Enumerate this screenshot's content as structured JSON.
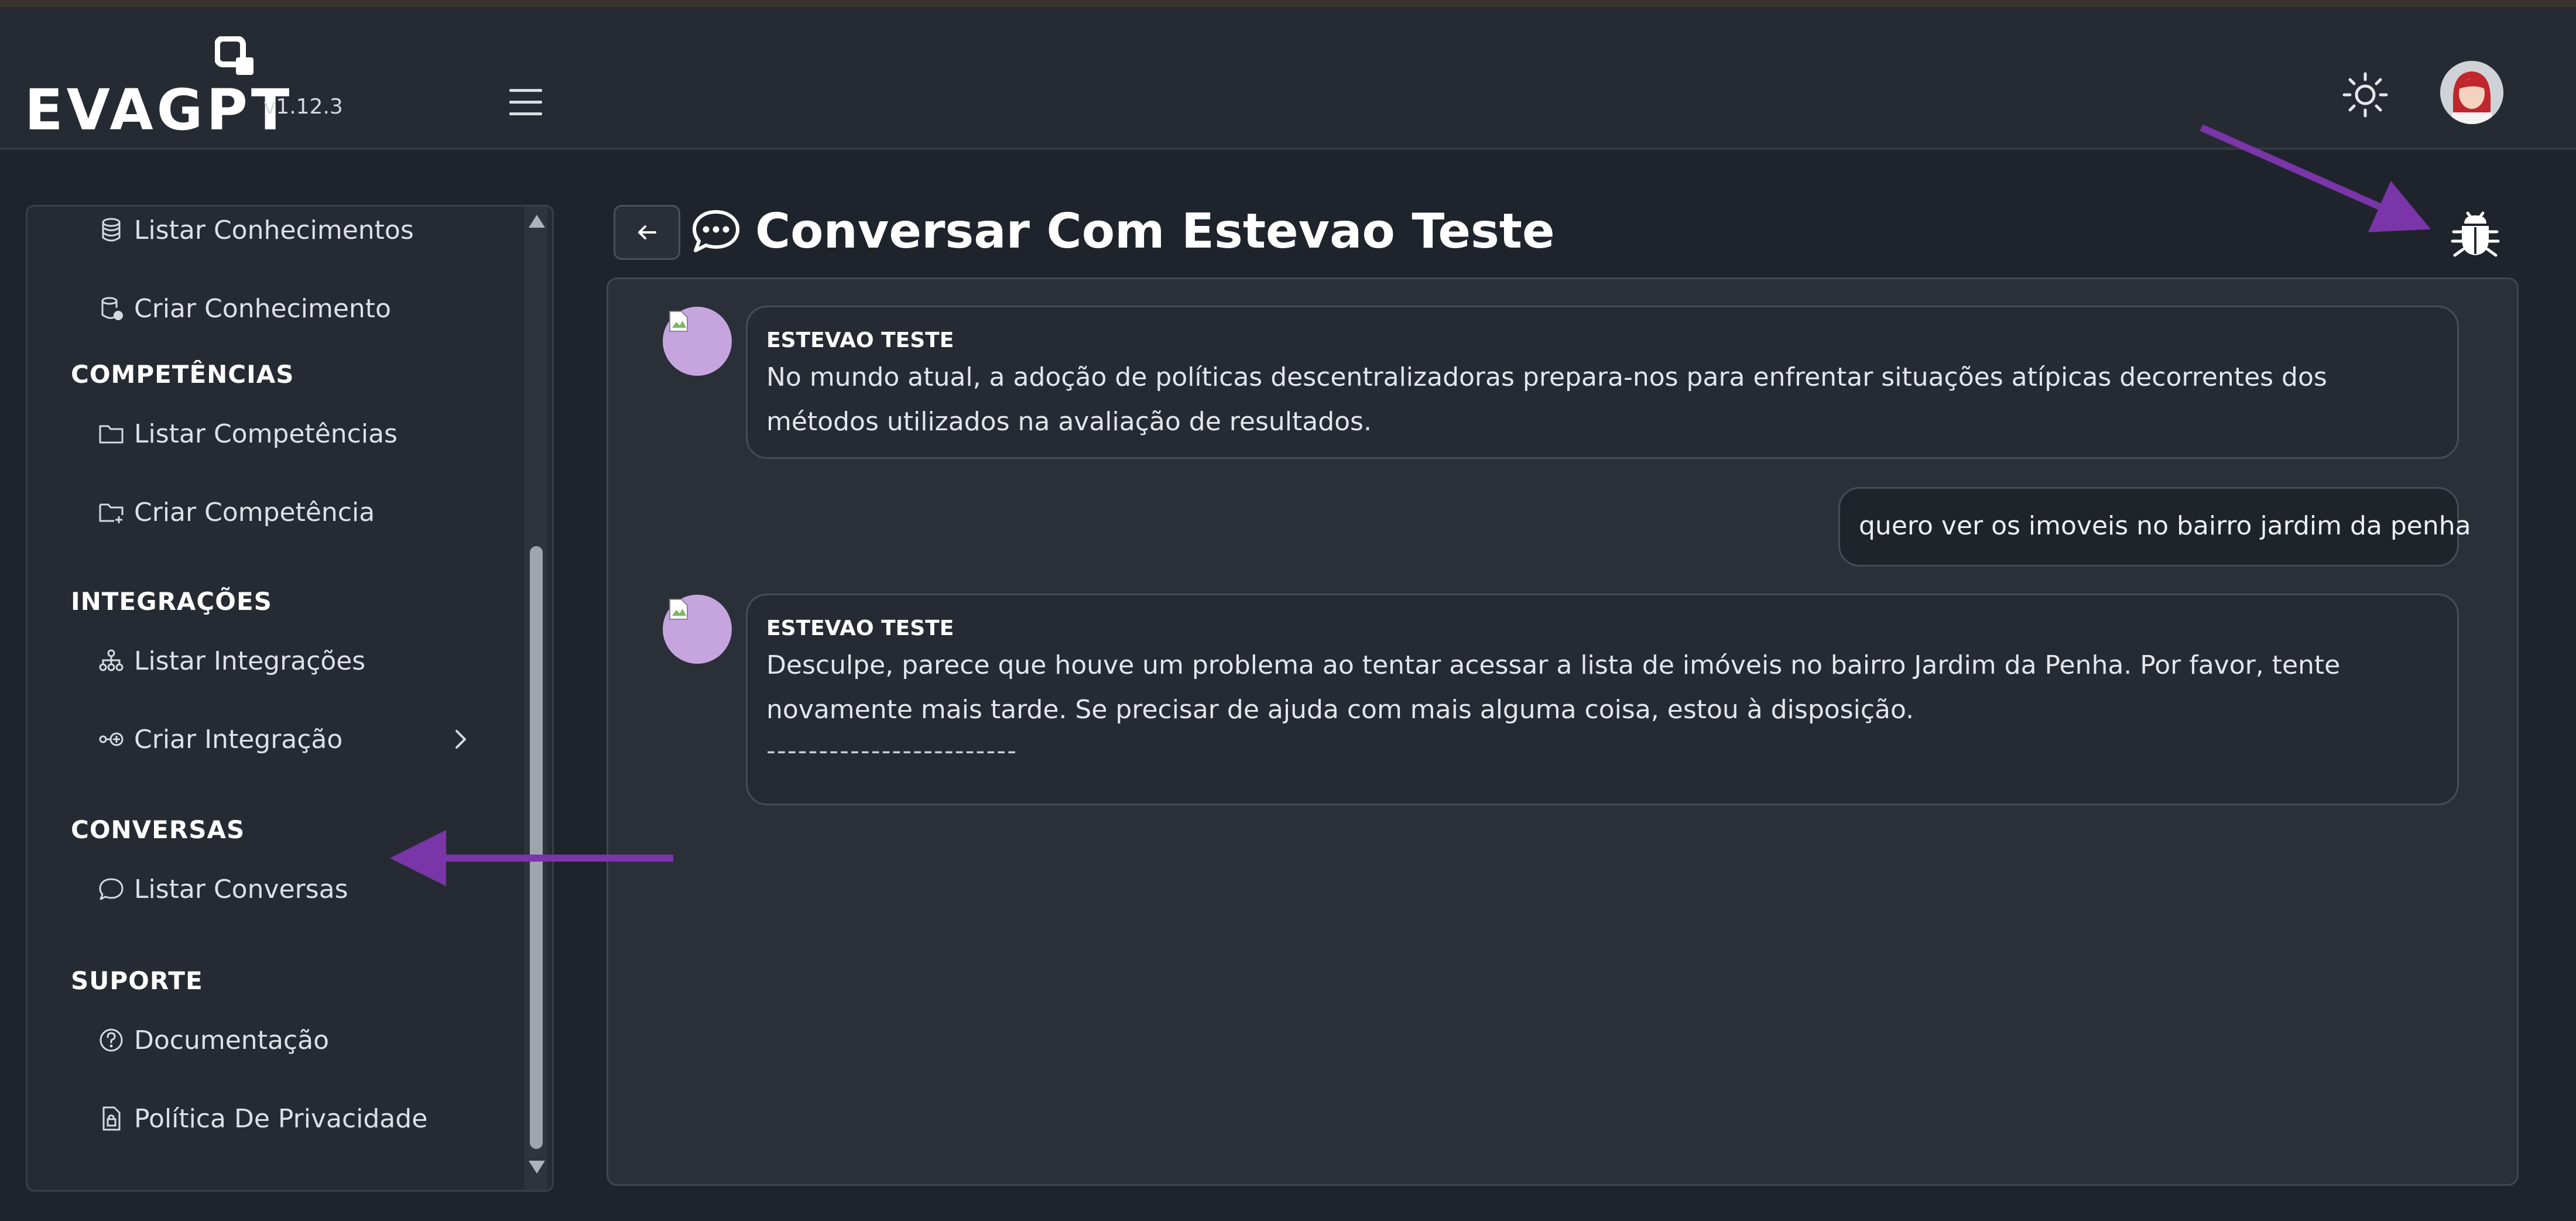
{
  "app": {
    "logo_text": "EVAGPT",
    "version": "v1.12.3"
  },
  "header": {
    "menu_icon": "hamburger-menu-icon",
    "theme_icon": "sun-icon",
    "avatar_icon": "user-avatar"
  },
  "sidebar": {
    "items_top": [
      {
        "label": "Listar Conhecimentos",
        "icon": "database-icon"
      },
      {
        "label": "Criar Conhecimento",
        "icon": "database-add-icon"
      }
    ],
    "sections": [
      {
        "title": "COMPETÊNCIAS",
        "items": [
          {
            "label": "Listar Competências",
            "icon": "folder-icon"
          },
          {
            "label": "Criar Competência",
            "icon": "folder-add-icon"
          }
        ]
      },
      {
        "title": "INTEGRAÇÕES",
        "items": [
          {
            "label": "Listar Integrações",
            "icon": "network-icon"
          },
          {
            "label": "Criar Integração",
            "icon": "integration-add-icon"
          }
        ]
      },
      {
        "title": "CONVERSAS",
        "items": [
          {
            "label": "Listar Conversas",
            "icon": "chat-bubble-icon"
          }
        ]
      },
      {
        "title": "SUPORTE",
        "items": [
          {
            "label": "Documentação",
            "icon": "question-circle-icon"
          },
          {
            "label": "Política De Privacidade",
            "icon": "file-lock-icon"
          }
        ]
      }
    ]
  },
  "page": {
    "title": "Conversar Com Estevao Teste"
  },
  "messages": [
    {
      "sender": "ESTEVAO TESTE",
      "text": "No mundo atual, a adoção de políticas descentralizadoras prepara-nos para enfrentar situações atípicas decorrentes dos métodos utilizados na avaliação de resultados."
    },
    {
      "user_text": "quero ver os imoveis no bairro jardim da penha"
    },
    {
      "sender": "ESTEVAO TESTE",
      "text": "Desculpe, parece que houve um problema ao tentar acessar a lista de imóveis no bairro Jardim da Penha. Por favor, tente novamente mais tarde. Se precisar de ajuda com mais alguma coisa, estou à disposição.",
      "separator": "------------------------"
    }
  ],
  "colors": {
    "background": "#1f242c",
    "panel": "#2a2f38",
    "avatar": "#c6a5de",
    "annotation_arrow": "#7a35a8"
  }
}
